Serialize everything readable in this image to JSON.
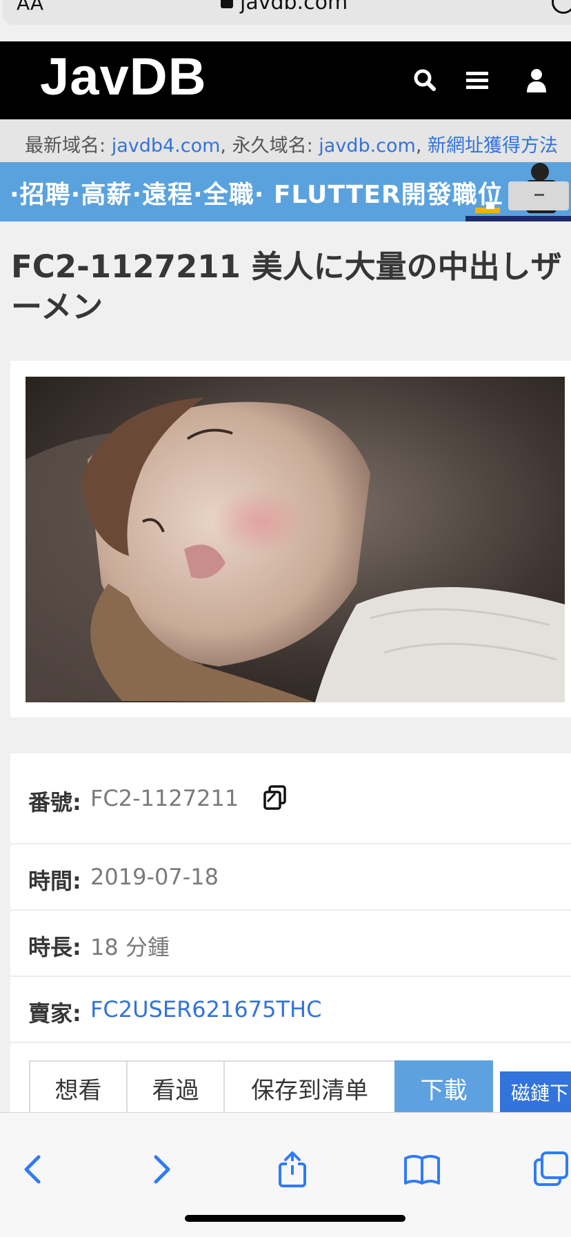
{
  "browser": {
    "text_size_label": "AA",
    "url": "javdb.com"
  },
  "navbar": {
    "logo": "JavDB",
    "icons": [
      "search-icon",
      "menu-icon",
      "user-icon"
    ]
  },
  "notice": {
    "latest_label": "最新域名: ",
    "latest_domain": "javdb4.com",
    "separator": ", ",
    "permanent_label": "永久域名: ",
    "permanent_domain": "javdb.com",
    "comma": ", ",
    "new_url_link": "新網址獲得方法"
  },
  "banner": {
    "text": "·招聘·高薪·遠程·全職· FLUTTER開發職位"
  },
  "movie": {
    "title": "FC2-1127211 美人に大量の中出しザーメン",
    "info": {
      "code_label": "番號:",
      "code_value": "FC2-1127211",
      "date_label": "時間:",
      "date_value": "2019-07-18",
      "duration_label": "時長:",
      "duration_value": "18 分鍾",
      "seller_label": "賣家:",
      "seller_value": "FC2USER621675THC"
    }
  },
  "actions": {
    "want": "想看",
    "watched": "看過",
    "save_list": "保存到清单",
    "download": "下載",
    "magnet": "磁鏈下"
  },
  "toolbar": {
    "icons": [
      "back-icon",
      "forward-icon",
      "share-icon",
      "bookmarks-icon",
      "tabs-icon"
    ]
  },
  "colors": {
    "link": "#3273dc",
    "banner": "#5aa2de",
    "primary_button": "#5da1e0"
  }
}
